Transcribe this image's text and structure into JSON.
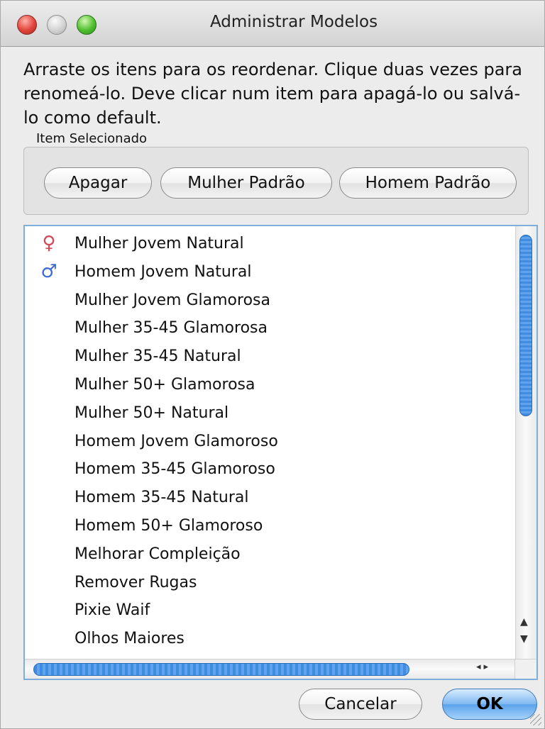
{
  "window": {
    "title": "Administrar Modelos"
  },
  "instructions": "Arraste os itens para os reordenar. Clique duas vezes para renomeá-lo.  Deve clicar num item para apagá-lo ou salvá-lo como default.",
  "selected_group": {
    "label": "Item Selecionado",
    "buttons": {
      "delete": "Apagar",
      "default_female": "Mulher Padrão",
      "default_male": "Homem Padrão"
    }
  },
  "models": [
    {
      "label": "Mulher Jovem Natural",
      "icon": "female-icon",
      "symbol": "♀"
    },
    {
      "label": "Homem Jovem Natural",
      "icon": "male-icon",
      "symbol": "♂"
    },
    {
      "label": "Mulher Jovem Glamorosa"
    },
    {
      "label": "Mulher 35-45 Glamorosa"
    },
    {
      "label": "Mulher 35-45 Natural"
    },
    {
      "label": "Mulher 50+ Glamorosa"
    },
    {
      "label": "Mulher 50+ Natural"
    },
    {
      "label": "Homem Jovem Glamoroso"
    },
    {
      "label": "Homem 35-45 Glamoroso"
    },
    {
      "label": "Homem 35-45 Natural"
    },
    {
      "label": "Homem 50+ Glamoroso"
    },
    {
      "label": "Melhorar Compleição"
    },
    {
      "label": "Remover Rugas"
    },
    {
      "label": "Pixie Waif"
    },
    {
      "label": "Olhos Maiores"
    }
  ],
  "footer": {
    "cancel": "Cancelar",
    "ok": "OK"
  }
}
